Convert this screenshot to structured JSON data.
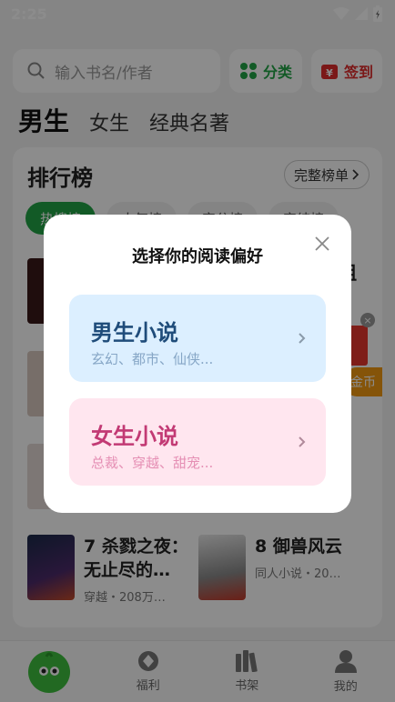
{
  "status_bar": {
    "time": "2:25"
  },
  "search": {
    "placeholder": "输入书名/作者"
  },
  "header_buttons": {
    "category": "分类",
    "sign_in": "签到"
  },
  "channel_tabs": {
    "active": "男生",
    "items": [
      "女生",
      "经典名著"
    ]
  },
  "ranking": {
    "title": "排行榜",
    "full_list": "完整榜单",
    "tabs": [
      "热搜榜",
      "人气榜",
      "完分榜",
      "完结榜"
    ],
    "partial_text": "狙",
    "coin_label": "金币"
  },
  "books": [
    {
      "num_title": "7 杀戮之夜：",
      "num_title_2": "无止尽的…",
      "meta": "穿越・208万…"
    },
    {
      "num_title": "8 御兽风云",
      "meta": "同人小说・20…"
    }
  ],
  "bottom_nav": {
    "items": [
      "福利",
      "书架",
      "我的"
    ]
  },
  "modal": {
    "title": "选择你的阅读偏好",
    "male": {
      "title": "男生小说",
      "subtitle": "玄幻、都市、仙侠..."
    },
    "female": {
      "title": "女生小说",
      "subtitle": "总裁、穿越、甜宠..."
    }
  },
  "colors": {
    "brand_green": "#22a546",
    "accent_red": "#e02d2d",
    "male_bg": "#dcefff",
    "female_bg": "#ffe6ef"
  }
}
